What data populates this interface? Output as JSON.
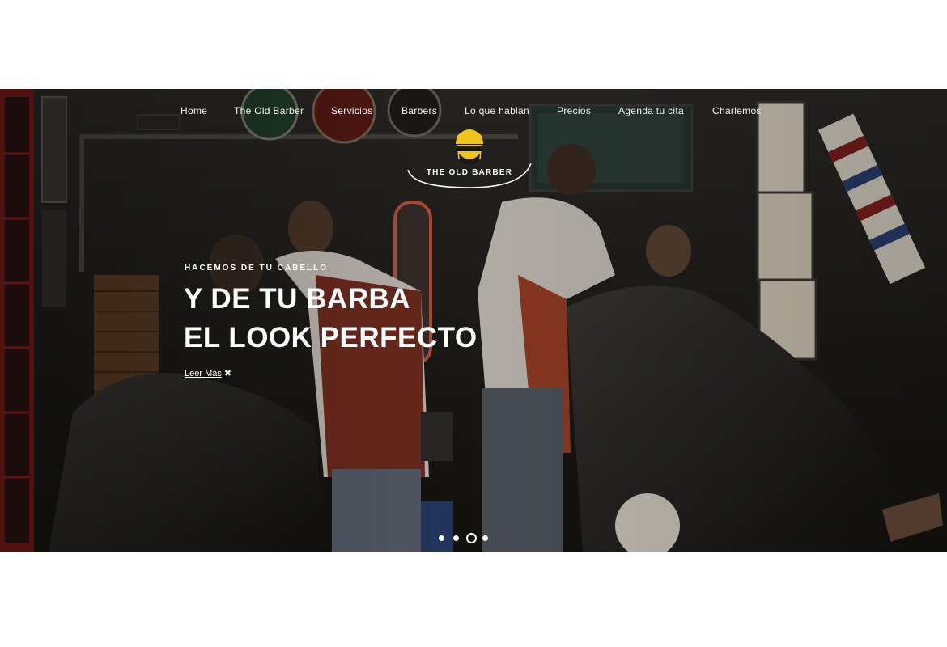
{
  "nav": {
    "items": [
      {
        "label": "Home"
      },
      {
        "label": "The Old Barber"
      },
      {
        "label": "Servicios"
      },
      {
        "label": "Barbers"
      },
      {
        "label": "Lo que hablan"
      },
      {
        "label": "Precios"
      },
      {
        "label": "Agenda tu cita"
      },
      {
        "label": "Charlemos"
      }
    ]
  },
  "logo": {
    "text": "THE OLD BARBER",
    "icon": "barber-face-icon",
    "color": "#f2c31b"
  },
  "hero": {
    "eyebrow": "HACEMOS DE TU CABELLO",
    "headline_line1": "Y DE TU BARBA",
    "headline_line2": "EL LOOK PERFECTO",
    "read_more": "Leer Más",
    "read_more_icon": "scissors-x-icon"
  },
  "slider": {
    "total_slides": 4,
    "active_slide": 3
  }
}
